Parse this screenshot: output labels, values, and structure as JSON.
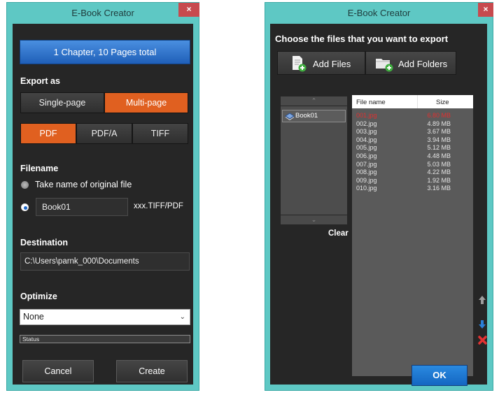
{
  "left_window": {
    "title": "E-Book Creator",
    "close": "×",
    "summary_button": "1 Chapter, 10 Pages total",
    "export_as": {
      "label": "Export as",
      "layout_options": [
        "Single-page",
        "Multi-page"
      ],
      "layout_selected": "Multi-page",
      "format_options": [
        "PDF",
        "PDF/A",
        "TIFF"
      ],
      "format_selected": "PDF"
    },
    "filename": {
      "label": "Filename",
      "option_original": "Take name of original file",
      "custom_value": "Book01",
      "extension_hint": "xxx.TIFF/PDF"
    },
    "destination": {
      "label": "Destination",
      "path": "C:\\Users\\parnk_000\\Documents"
    },
    "optimize": {
      "label": "Optimize",
      "selected": "None"
    },
    "status_text": "Status",
    "cancel_label": "Cancel",
    "create_label": "Create"
  },
  "right_window": {
    "title": "E-Book Creator",
    "close": "×",
    "instruction": "Choose the files that you want to export",
    "add_files_label": "Add Files",
    "add_folders_label": "Add Folders",
    "tree_items": [
      "Book01"
    ],
    "clear_label": "Clear",
    "columns": {
      "name": "File name",
      "size": "Size"
    },
    "files": [
      {
        "name": "001.jpg",
        "size": "6.80 MB",
        "selected": true
      },
      {
        "name": "002.jpg",
        "size": "4.89 MB"
      },
      {
        "name": "003.jpg",
        "size": "3.67 MB"
      },
      {
        "name": "004.jpg",
        "size": "3.94 MB"
      },
      {
        "name": "005.jpg",
        "size": "5.12 MB"
      },
      {
        "name": "006.jpg",
        "size": "4.48 MB"
      },
      {
        "name": "007.jpg",
        "size": "5.03 MB"
      },
      {
        "name": "008.jpg",
        "size": "4.22 MB"
      },
      {
        "name": "009.jpg",
        "size": "1.92 MB"
      },
      {
        "name": "010.jpg",
        "size": "3.16 MB"
      }
    ],
    "ok_label": "OK"
  },
  "colors": {
    "frame": "#5ec8c4",
    "client": "#262626",
    "accent_orange": "#e06020",
    "accent_blue": "#1f5fb8",
    "close_red": "#c74a4e",
    "selected_file": "#e03030"
  }
}
